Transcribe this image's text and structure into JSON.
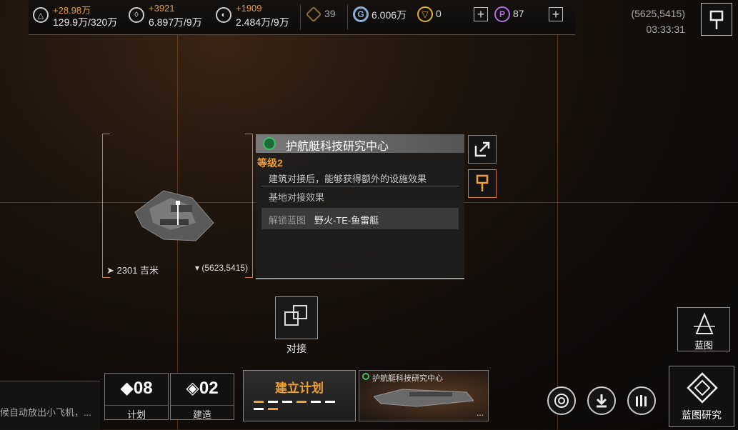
{
  "topbar": {
    "resources": [
      {
        "icon": "triangle-icon",
        "delta": "+28.98万",
        "amount": "129.9万/320万"
      },
      {
        "icon": "crystal-icon",
        "delta": "+3921",
        "amount": "6.897万/9万"
      },
      {
        "icon": "gas-icon",
        "delta": "+1909",
        "amount": "2.484万/9万"
      }
    ],
    "token_count": "39",
    "credits": "6.006万",
    "gold": "0",
    "premium": "87",
    "coordinates": "(5625,5415)",
    "time": "03:33:31"
  },
  "selection": {
    "distance": "2301 吉米",
    "location": "(5623,5415)",
    "title": "护航艇科技研究中心",
    "level": "等级2",
    "description": "建筑对接后，能够获得额外的设施效果",
    "base_effect": "基地对接效果",
    "unlock_label": "解锁蓝图",
    "unlock_value": "野火-TE-鱼雷艇"
  },
  "dock": {
    "label": "对接"
  },
  "bottom": {
    "ticker": "候自动放出小飞机，...",
    "plan_count": "08",
    "plan_label": "计划",
    "build_count": "02",
    "build_label": "建造",
    "create_plan": "建立计划",
    "thumb_title": "护航艇科技研究中心",
    "thumb_more": "...",
    "blueprint": "蓝图",
    "blueprint_research": "蓝图研究"
  },
  "colors": {
    "accent": "#f0a030",
    "grid": "#c8783c"
  }
}
